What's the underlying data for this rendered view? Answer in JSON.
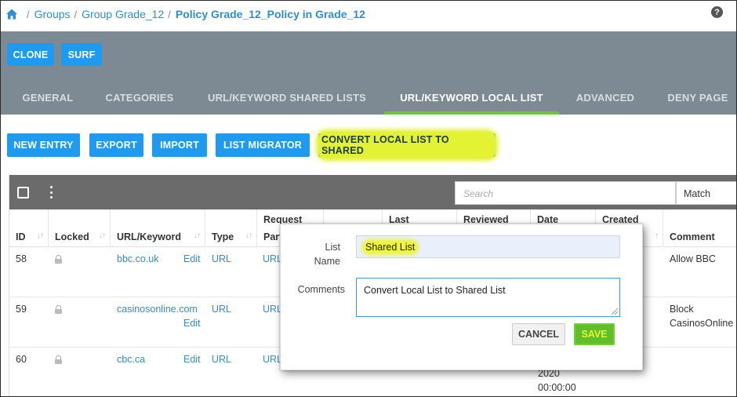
{
  "breadcrumb": {
    "home_icon": "home-icon",
    "items": [
      "Groups",
      "Group Grade_12"
    ],
    "current": "Policy Grade_12_Policy in Grade_12",
    "separator": "/"
  },
  "help_icon": "?",
  "header_buttons": {
    "clone": "CLONE",
    "surf": "SURF"
  },
  "tabs": [
    {
      "label": "GENERAL",
      "active": false
    },
    {
      "label": "CATEGORIES",
      "active": false
    },
    {
      "label": "URL/KEYWORD SHARED LISTS",
      "active": false
    },
    {
      "label": "URL/KEYWORD LOCAL LIST",
      "active": true
    },
    {
      "label": "ADVANCED",
      "active": false
    },
    {
      "label": "DENY PAGE",
      "active": false
    }
  ],
  "actions": {
    "new_entry": "NEW ENTRY",
    "export": "EXPORT",
    "import": "IMPORT",
    "list_migrator": "LIST MIGRATOR",
    "convert": "CONVERT LOCAL LIST TO SHARED"
  },
  "grid": {
    "search_placeholder": "Search",
    "match_label": "Match",
    "columns": [
      {
        "label": "ID",
        "label_top": ""
      },
      {
        "label": "Locked",
        "label_top": ""
      },
      {
        "label": "URL/Keyword",
        "label_top": ""
      },
      {
        "label": "Type",
        "label_top": ""
      },
      {
        "label": "Part",
        "label_top": "Request"
      },
      {
        "label": "",
        "label_top": ""
      },
      {
        "label": "",
        "label_top": "Last"
      },
      {
        "label": "",
        "label_top": "Reviewed"
      },
      {
        "label": "",
        "label_top": "Date"
      },
      {
        "label": "",
        "label_top": "Created"
      },
      {
        "label": "Comment",
        "label_top": ""
      }
    ],
    "rows": [
      {
        "id": "58",
        "url": "bbc.co.uk",
        "edit": "Edit",
        "type": "URL",
        "part": "URL",
        "date_1": "",
        "date_2": "",
        "comment_1": "Allow BBC",
        "comment_2": ""
      },
      {
        "id": "59",
        "url": "casinosonline.com",
        "edit": "Edit",
        "type": "URL",
        "part": "URL",
        "date_1": "",
        "date_2": "",
        "comment_1": "Block",
        "comment_2": "CasinosOnline"
      },
      {
        "id": "60",
        "url": "cbc.ca",
        "edit": "Edit",
        "type": "URL",
        "part": "URL",
        "date_1": "2020",
        "date_2": "00:00:00",
        "comment_1": "",
        "comment_2": ""
      }
    ]
  },
  "dialog": {
    "list_name_label_1": "List",
    "list_name_label_2": "Name",
    "list_name_value": "Shared List",
    "comments_label": "Comments",
    "comments_value": "Convert Local List to Shared List",
    "cancel": "CANCEL",
    "save": "SAVE"
  },
  "colors": {
    "accent_blue": "#1e9bf0",
    "header_gray": "#7d8a93",
    "active_tab_underline": "#6cc43a",
    "save_green": "#5fbe2a",
    "highlight_yellow": "#eef53a"
  }
}
